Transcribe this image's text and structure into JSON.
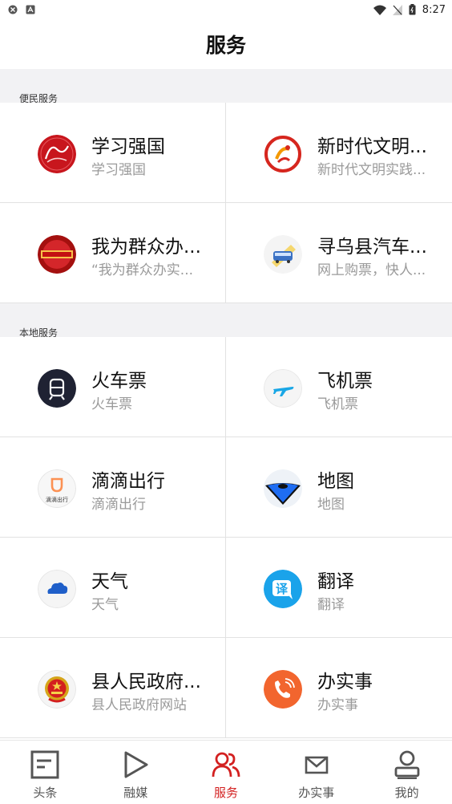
{
  "status_bar": {
    "time": "8:27"
  },
  "header": {
    "title": "服务"
  },
  "sections": [
    {
      "label": "便民服务",
      "items": [
        {
          "title": "学习强国",
          "subtitle": "学习强国",
          "icon": "xuexi-qiangguo-logo"
        },
        {
          "title": "新时代文明...",
          "subtitle": "新时代文明实践...",
          "icon": "civilization-logo"
        },
        {
          "title": "我为群众办...",
          "subtitle": "“我为群众办实...",
          "icon": "serve-people-logo"
        },
        {
          "title": "寻乌县汽车...",
          "subtitle": "网上购票，快人...",
          "icon": "bus-ticket-logo"
        }
      ]
    },
    {
      "label": "本地服务",
      "items": [
        {
          "title": "火车票",
          "subtitle": "火车票",
          "icon": "train-icon"
        },
        {
          "title": "飞机票",
          "subtitle": "飞机票",
          "icon": "airplane-icon"
        },
        {
          "title": "滴滴出行",
          "subtitle": "滴滴出行",
          "icon": "didi-icon",
          "icon_text": "滴滴出行"
        },
        {
          "title": "地图",
          "subtitle": "地图",
          "icon": "map-pin-icon"
        },
        {
          "title": "天气",
          "subtitle": "天气",
          "icon": "cloud-icon"
        },
        {
          "title": "翻译",
          "subtitle": "翻译",
          "icon": "translate-icon",
          "icon_text": "译"
        },
        {
          "title": "县人民政府...",
          "subtitle": "县人民政府网站",
          "icon": "national-emblem-icon"
        },
        {
          "title": "办实事",
          "subtitle": "办实事",
          "icon": "phone-icon"
        }
      ]
    }
  ],
  "bottom_nav": [
    {
      "label": "头条",
      "icon": "headline-icon",
      "active": false
    },
    {
      "label": "融媒",
      "icon": "play-icon",
      "active": false
    },
    {
      "label": "服务",
      "icon": "people-icon",
      "active": true
    },
    {
      "label": "办实事",
      "icon": "mail-icon",
      "active": false
    },
    {
      "label": "我的",
      "icon": "profile-icon",
      "active": false
    }
  ],
  "colors": {
    "accent": "#d32020",
    "section_bg": "#f2f2f4",
    "subtitle": "#9a9a9a"
  }
}
